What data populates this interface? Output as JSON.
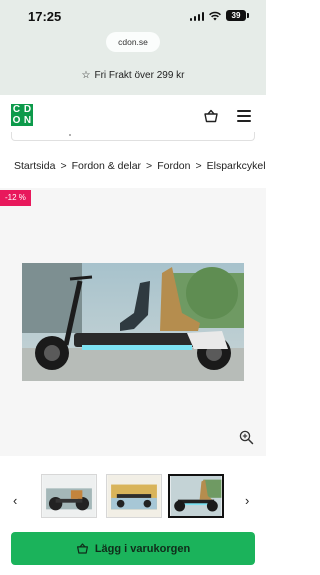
{
  "status_bar": {
    "time": "17:25",
    "battery": "39"
  },
  "browser": {
    "url": "cdon.se"
  },
  "promo": {
    "text": "Fri Frakt över 299 kr",
    "icon": "star-icon"
  },
  "header": {
    "logo_letters": [
      "C",
      "D",
      "O",
      "N"
    ],
    "brand_color": "#0c9a4a"
  },
  "breadcrumb": {
    "items": [
      "Startsida",
      "Fordon & delar",
      "Fordon",
      "Elsparkcykel"
    ],
    "separator": ">"
  },
  "product": {
    "discount_badge": "-12 %",
    "discount_color": "#e8195c"
  },
  "thumbnails": {
    "count": 3,
    "active_index": 2,
    "prev_label": "‹",
    "next_label": "›"
  },
  "actions": {
    "add_to_cart": "Lägg i varukorgen",
    "button_color": "#1bb35b"
  }
}
